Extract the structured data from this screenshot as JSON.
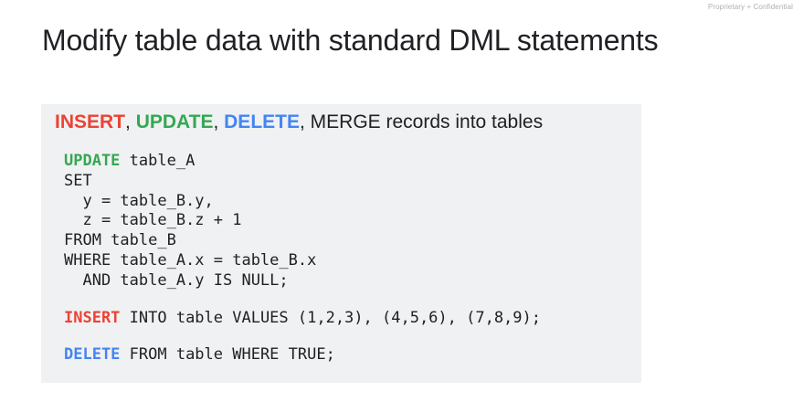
{
  "header": {
    "notice": "Proprietary + Confidential",
    "title": "Modify table data with standard DML statements"
  },
  "panel": {
    "headline": {
      "insert": "INSERT",
      "sep1": ", ",
      "update": "UPDATE",
      "sep2": ", ",
      "delete": "DELETE",
      "rest": ", MERGE records into tables"
    },
    "update_stmt": {
      "keyword": "UPDATE",
      "line1_rest": " table_A",
      "line2": "SET",
      "line3": "  y = table_B.y,",
      "line4": "  z = table_B.z + 1",
      "line5": "FROM table_B",
      "line6": "WHERE table_A.x = table_B.x",
      "line7": "  AND table_A.y IS NULL;"
    },
    "insert_stmt": {
      "keyword": "INSERT",
      "rest": " INTO table VALUES (1,2,3), (4,5,6), (7,8,9);"
    },
    "delete_stmt": {
      "keyword": "DELETE",
      "rest": " FROM table WHERE TRUE;"
    }
  },
  "colors": {
    "insert": "#ea4335",
    "update": "#34a853",
    "delete": "#4285f4",
    "panel_background": "#f0f1f2",
    "text": "#202124"
  }
}
